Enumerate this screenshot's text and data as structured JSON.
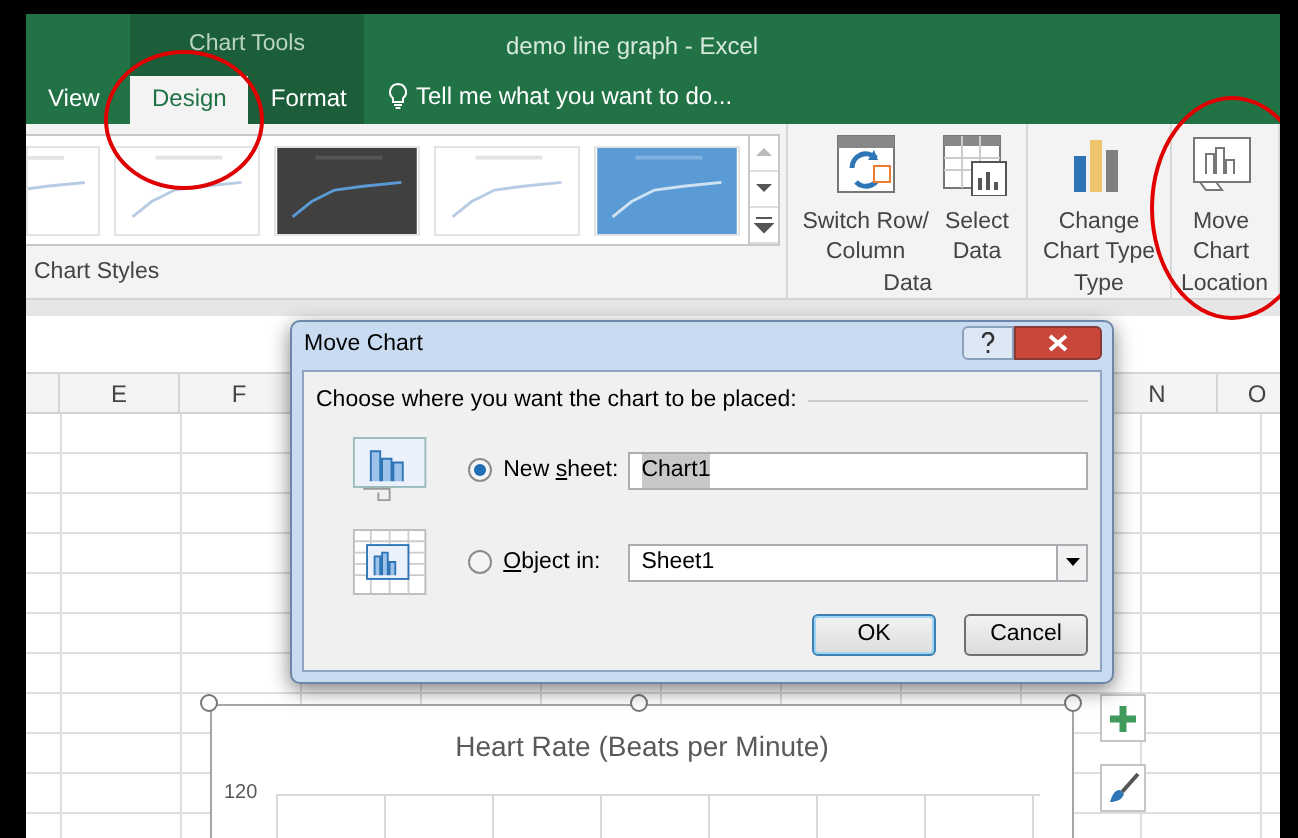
{
  "window": {
    "context_title": "Chart Tools",
    "title": "demo line graph - Excel"
  },
  "tabs": [
    {
      "label": "View",
      "selected": false,
      "circled": false
    },
    {
      "label": "Design",
      "selected": true,
      "circled": true
    },
    {
      "label": "Format",
      "selected": false,
      "circled": false
    }
  ],
  "tell_me": {
    "text": "Tell me what you want to do..."
  },
  "chart_styles": {
    "label": "Chart Styles",
    "thumbnails": [
      {
        "kind": "light"
      },
      {
        "kind": "light"
      },
      {
        "kind": "dark"
      },
      {
        "kind": "light"
      },
      {
        "kind": "blue"
      }
    ]
  },
  "ribbon_groups": [
    {
      "label": "Data",
      "buttons": [
        {
          "kind": "switch",
          "lines": [
            "Switch Row/",
            "Column"
          ],
          "circled": false
        },
        {
          "kind": "select",
          "lines": [
            "Select",
            "Data"
          ],
          "circled": false
        }
      ]
    },
    {
      "label": "Type",
      "buttons": [
        {
          "kind": "bars",
          "lines": [
            "Change",
            "Chart Type"
          ],
          "circled": false
        }
      ]
    },
    {
      "label": "Location",
      "buttons": [
        {
          "kind": "move",
          "lines": [
            "Move",
            "Chart"
          ],
          "circled": true
        }
      ]
    }
  ],
  "columns_left": [
    "E",
    "F"
  ],
  "columns_right": [
    "N",
    "O"
  ],
  "dialog": {
    "title": "Move Chart",
    "prompt": "Choose where you want the chart to be placed:",
    "options": [
      {
        "kind": "text",
        "label": "New sheet:",
        "selected": true,
        "value": "Chart1",
        "value_highlighted": true
      },
      {
        "kind": "dropdown",
        "label": "Object in:",
        "selected": false,
        "value": "Sheet1",
        "value_highlighted": false
      }
    ],
    "buttons": [
      {
        "label": "OK",
        "default": true
      },
      {
        "label": "Cancel",
        "default": false
      }
    ]
  },
  "chart": {
    "title": "Heart Rate (Beats per Minute)",
    "y_tick_label": "120",
    "selected": true
  }
}
